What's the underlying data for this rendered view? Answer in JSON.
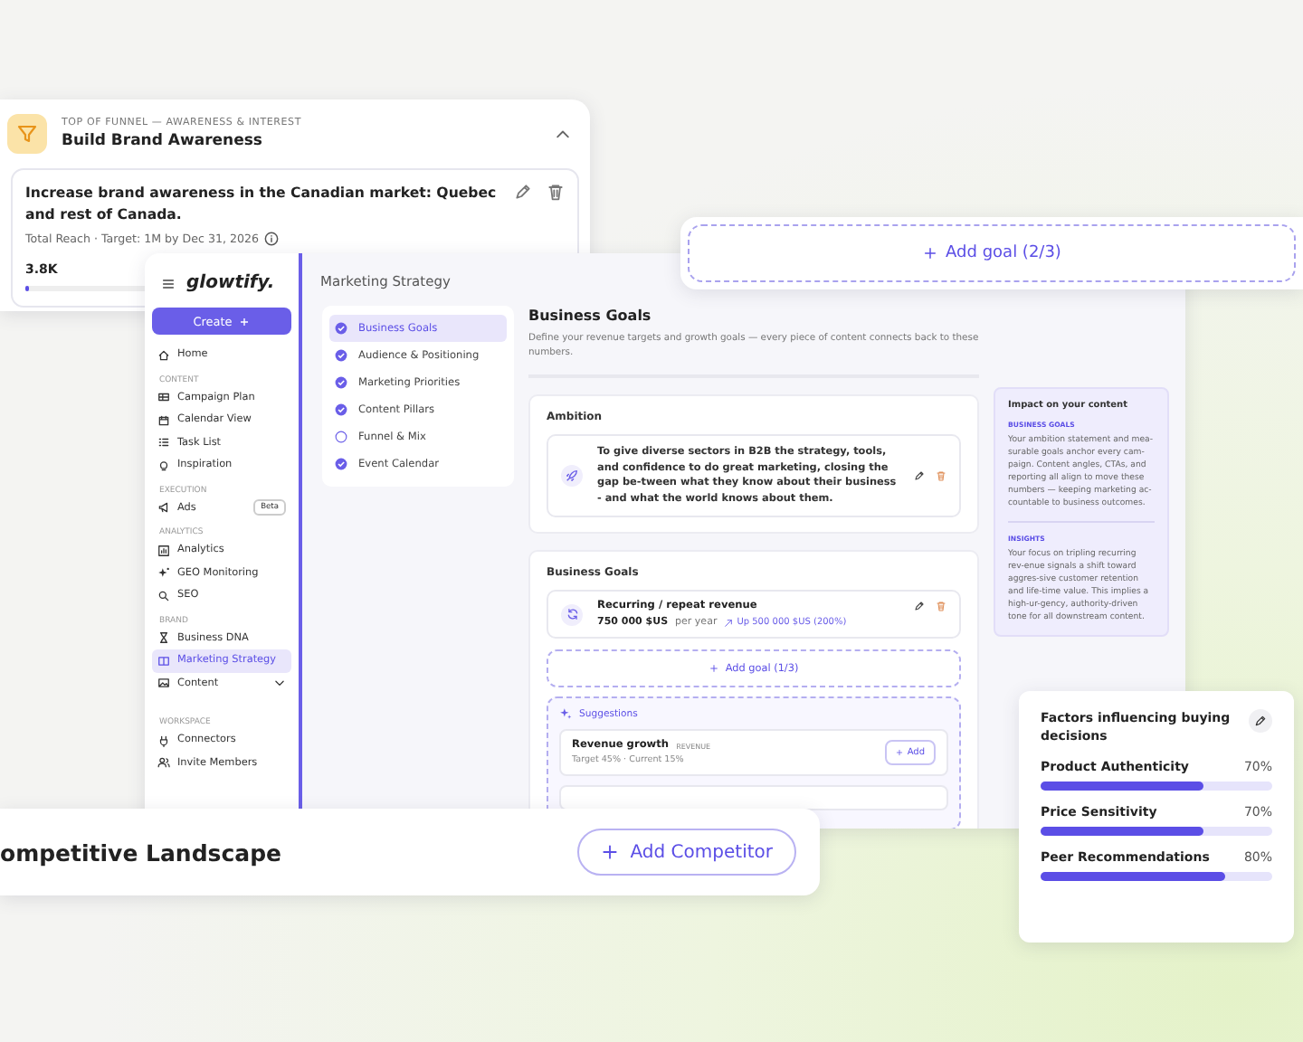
{
  "funnel_card": {
    "eyebrow": "TOP OF FUNNEL — AWARENESS & INTEREST",
    "title": "Build Brand Awareness",
    "expanded": true,
    "goal": {
      "text": "Increase brand awareness in the Canadian market: Quebec and rest of Canada.",
      "meta": "Total Reach · Target: 1M by Dec 31, 2026",
      "value": "3.8K",
      "level": 0.004
    }
  },
  "add_goal_card": {
    "label": "Add goal (2/3)"
  },
  "app": {
    "brand": "glowtify.",
    "create_button": "Create",
    "nav": [
      {
        "kind": "item",
        "label": "Home",
        "selected": false
      },
      {
        "kind": "section",
        "label": "CONTENT"
      },
      {
        "kind": "item",
        "label": "Campaign Plan",
        "selected": false
      },
      {
        "kind": "item",
        "label": "Calendar View",
        "selected": false
      },
      {
        "kind": "item",
        "label": "Task List",
        "selected": false
      },
      {
        "kind": "item",
        "label": "Inspiration",
        "selected": false
      },
      {
        "kind": "section",
        "label": "EXECUTION"
      },
      {
        "kind": "item",
        "label": "Ads",
        "badge": "Beta",
        "selected": false
      },
      {
        "kind": "section",
        "label": "ANALYTICS"
      },
      {
        "kind": "item",
        "label": "Analytics",
        "selected": false
      },
      {
        "kind": "item",
        "label": "GEO Monitoring",
        "selected": false
      },
      {
        "kind": "item",
        "label": "SEO",
        "selected": false
      },
      {
        "kind": "section",
        "label": "BRAND"
      },
      {
        "kind": "item",
        "label": "Business DNA",
        "selected": false
      },
      {
        "kind": "item",
        "label": "Marketing Strategy",
        "selected": true
      },
      {
        "kind": "item",
        "label": "Content",
        "selected": false,
        "expanded": false
      },
      {
        "kind": "gap"
      },
      {
        "kind": "section",
        "label": "WORKSPACE"
      },
      {
        "kind": "item",
        "label": "Connectors",
        "selected": false
      },
      {
        "kind": "item",
        "label": "Invite Members",
        "selected": false
      }
    ],
    "page_title": "Marketing Strategy",
    "steps": [
      {
        "label": "Business Goals",
        "done": true,
        "selected": true
      },
      {
        "label": "Audience & Positioning",
        "done": true,
        "selected": false
      },
      {
        "label": "Marketing Priorities",
        "done": true,
        "selected": false
      },
      {
        "label": "Content Pillars",
        "done": true,
        "selected": false
      },
      {
        "label": "Funnel & Mix",
        "done": false,
        "selected": false
      },
      {
        "label": "Event Calendar",
        "done": true,
        "selected": false
      }
    ],
    "heading": "Business Goals",
    "description": "Define your revenue targets and growth goals — every piece of content connects back to these numbers.",
    "ambition": {
      "title": "Ambition",
      "text": "To give diverse sectors in B2B the strategy, tools, and confidence to do great marketing, closing the gap be-tween what they know about their business - and what the world knows about them."
    },
    "business_goals": {
      "title": "Business Goals",
      "goals": [
        {
          "name": "Recurring / repeat revenue",
          "amount": "750 000 $US",
          "period": "per year",
          "change": "Up 500 000 $US (200%)"
        }
      ],
      "add_goal": "Add goal (1/3)",
      "suggestions": {
        "title": "Suggestions",
        "items": [
          {
            "name": "Revenue growth",
            "tag": "REVENUE",
            "meta": "Target 45% · Current 15%",
            "button": "Add"
          }
        ]
      }
    },
    "impact_panel": {
      "title": "Impact on your content",
      "sections": [
        {
          "heading": "BUSINESS GOALS",
          "text": "Your ambition statement and mea-surable goals anchor every cam-paign. Content angles, CTAs, and reporting all align to move these numbers — keeping marketing ac-countable to business outcomes."
        },
        {
          "heading": "INSIGHTS",
          "text": "Your focus on tripling recurring rev-enue signals a shift toward aggres-sive customer retention and life-time value. This implies a high-ur-gency, authority-driven tone for all downstream content."
        }
      ]
    }
  },
  "competitor_card": {
    "title": "ompetitive Landscape",
    "button": "Add Competitor"
  },
  "factors_card": {
    "title": "Factors influencing buying decisions",
    "factors": [
      {
        "name": "Product Authenticity",
        "reading": "70%",
        "level": 0.7
      },
      {
        "name": "Price Sensitivity",
        "reading": "70%",
        "level": 0.7
      },
      {
        "name": "Peer Recommendations",
        "reading": "80%",
        "level": 0.8
      }
    ]
  }
}
